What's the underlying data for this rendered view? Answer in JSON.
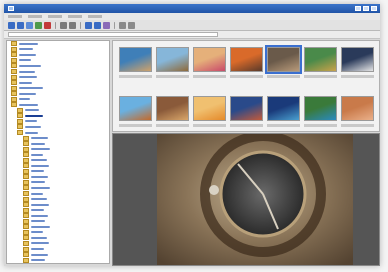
{
  "window": {
    "title": "",
    "icon": "app-icon"
  },
  "menu": {
    "items": [
      "",
      "",
      "",
      "",
      ""
    ]
  },
  "toolbar": {
    "buttons": [
      {
        "icon": "back-icon",
        "color": "#3a6cc4"
      },
      {
        "icon": "forward-icon",
        "color": "#3a6cc4"
      },
      {
        "icon": "up-icon",
        "color": "#5b8bd8"
      },
      {
        "icon": "refresh-icon",
        "color": "#4f9a4a"
      },
      {
        "icon": "delete-icon",
        "color": "#c23a3a"
      },
      {
        "icon": "copy-icon",
        "color": "#7a7a7a"
      },
      {
        "icon": "move-icon",
        "color": "#7a7a7a"
      },
      {
        "icon": "slideshow-icon",
        "color": "#3a6cc4"
      },
      {
        "icon": "fullscreen-icon",
        "color": "#3a6cc4"
      },
      {
        "icon": "rotate-icon",
        "color": "#8a6bb8"
      },
      {
        "icon": "zoom-icon",
        "color": "#8a8a8a"
      },
      {
        "icon": "settings-icon",
        "color": "#8a8a8a"
      }
    ]
  },
  "address": {
    "value": ""
  },
  "folder_tree": {
    "items": [
      {
        "depth": 0,
        "len": 16
      },
      {
        "depth": 0,
        "len": 12
      },
      {
        "depth": 0,
        "len": 14
      },
      {
        "depth": 0,
        "len": 10
      },
      {
        "depth": 0,
        "len": 18
      },
      {
        "depth": 0,
        "len": 13
      },
      {
        "depth": 0,
        "len": 15
      },
      {
        "depth": 0,
        "len": 11
      },
      {
        "depth": 0,
        "len": 20
      },
      {
        "depth": 0,
        "len": 14
      },
      {
        "depth": 0,
        "len": 9
      },
      {
        "depth": 0,
        "len": 16
      },
      {
        "depth": 1,
        "len": 12
      },
      {
        "depth": 1,
        "len": 15
      },
      {
        "depth": 1,
        "len": 10
      },
      {
        "depth": 1,
        "len": 13
      },
      {
        "depth": 1,
        "len": 11
      },
      {
        "depth": 2,
        "len": 14
      },
      {
        "depth": 2,
        "len": 12
      },
      {
        "depth": 2,
        "len": 16
      },
      {
        "depth": 2,
        "len": 10
      },
      {
        "depth": 2,
        "len": 13
      },
      {
        "depth": 2,
        "len": 15
      },
      {
        "depth": 2,
        "len": 11
      },
      {
        "depth": 2,
        "len": 14
      },
      {
        "depth": 2,
        "len": 12
      },
      {
        "depth": 2,
        "len": 16
      },
      {
        "depth": 2,
        "len": 10
      },
      {
        "depth": 2,
        "len": 13
      },
      {
        "depth": 2,
        "len": 15
      },
      {
        "depth": 2,
        "len": 11
      },
      {
        "depth": 2,
        "len": 14
      },
      {
        "depth": 2,
        "len": 12
      },
      {
        "depth": 2,
        "len": 16
      },
      {
        "depth": 2,
        "len": 10
      },
      {
        "depth": 2,
        "len": 13
      },
      {
        "depth": 2,
        "len": 15
      },
      {
        "depth": 2,
        "len": 11
      },
      {
        "depth": 2,
        "len": 14
      },
      {
        "depth": 2,
        "len": 12
      }
    ],
    "selected_index": 13
  },
  "thumbnails": {
    "row1": [
      {
        "colors": [
          "#3f7fb8",
          "#cfa26a"
        ]
      },
      {
        "colors": [
          "#86b6d9",
          "#8e6a3a"
        ]
      },
      {
        "colors": [
          "#e5b07a",
          "#c94a6a"
        ]
      },
      {
        "colors": [
          "#d96a2a",
          "#5a3a2a"
        ]
      },
      {
        "colors": [
          "#6a5a4a",
          "#b89a7a"
        ]
      },
      {
        "colors": [
          "#4a8a4a",
          "#c9a24a"
        ]
      },
      {
        "colors": [
          "#2a3a5a",
          "#e6e6e6"
        ]
      }
    ],
    "row2": [
      {
        "colors": [
          "#6ab0e0",
          "#c46a2a"
        ]
      },
      {
        "colors": [
          "#8a5a3a",
          "#d9a66a"
        ]
      },
      {
        "colors": [
          "#f0c070",
          "#e58a2a"
        ]
      },
      {
        "colors": [
          "#2a4a8a",
          "#c45a3a"
        ]
      },
      {
        "colors": [
          "#1a3a7a",
          "#4aa0d0"
        ]
      },
      {
        "colors": [
          "#3a7a3a",
          "#2a8ac0"
        ]
      },
      {
        "colors": [
          "#c97a4a",
          "#eab08a"
        ]
      }
    ],
    "selected_index": 4
  },
  "preview": {
    "bg_color": "#5a5a5a",
    "image_colors": [
      "#8a7458",
      "#4a3a2a",
      "#c9b89a",
      "#2a2a2a"
    ]
  }
}
